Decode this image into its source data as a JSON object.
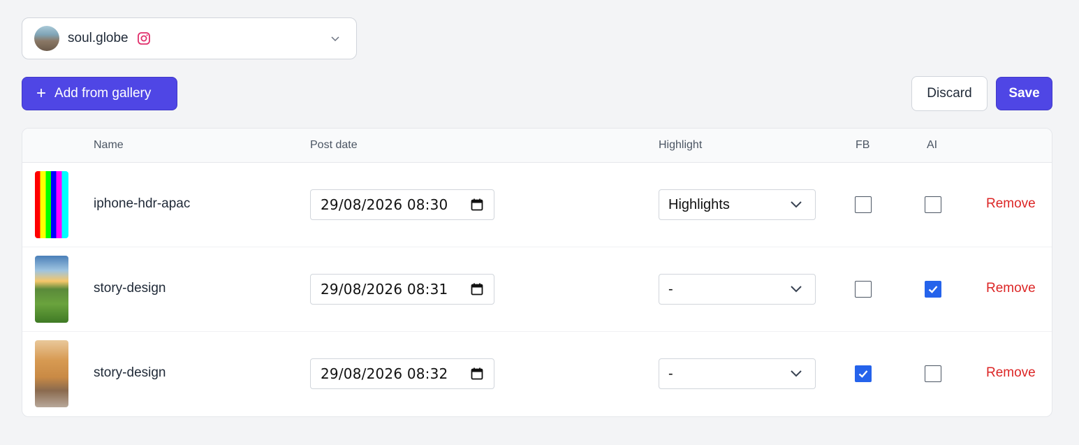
{
  "account": {
    "name": "soul.globe",
    "platform_icon": "instagram-icon"
  },
  "toolbar": {
    "add_label": "Add from gallery",
    "discard_label": "Discard",
    "save_label": "Save"
  },
  "table": {
    "headers": {
      "name": "Name",
      "post_date": "Post date",
      "highlight": "Highlight",
      "fb": "FB",
      "ai": "AI"
    },
    "rows": [
      {
        "name": "iphone-hdr-apac",
        "post_date": "29/08/2026 08:30",
        "highlight": "Highlights",
        "fb": false,
        "ai": false,
        "remove": "Remove"
      },
      {
        "name": "story-design",
        "post_date": "29/08/2026 08:31",
        "highlight": "-",
        "fb": false,
        "ai": true,
        "remove": "Remove"
      },
      {
        "name": "story-design",
        "post_date": "29/08/2026 08:32",
        "highlight": "-",
        "fb": true,
        "ai": false,
        "remove": "Remove"
      }
    ]
  },
  "colors": {
    "accent": "#4f46e5",
    "danger": "#dc2626",
    "checkbox": "#2563eb",
    "instagram": "#e1306c"
  }
}
